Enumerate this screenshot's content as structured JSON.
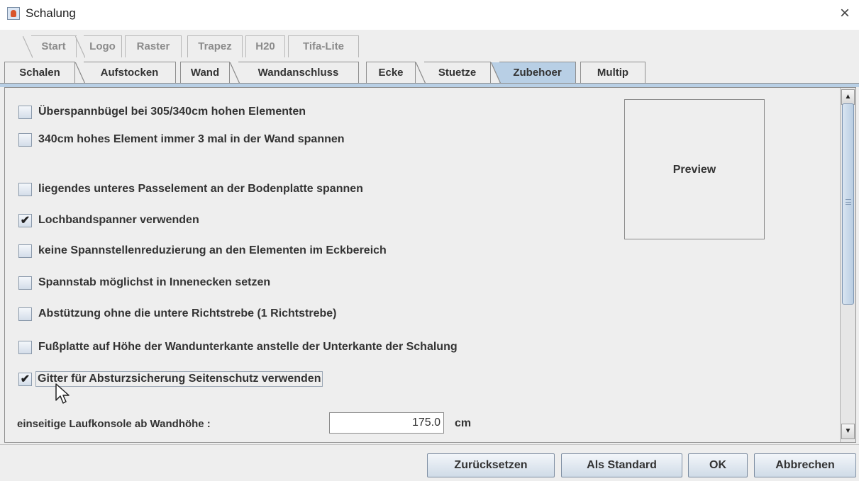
{
  "window": {
    "title": "Schalung",
    "close_symbol": "×",
    "app_icon": "java-cup-icon"
  },
  "tabs_row1": [
    "Start",
    "Logo",
    "Raster",
    "Trapez",
    "H20",
    "Tifa-Lite"
  ],
  "tabs_row2": [
    "Schalen",
    "Aufstocken",
    "Wand",
    "Wandanschluss",
    "Ecke",
    "Stuetze",
    "Zubehoer",
    "Multip"
  ],
  "selected_tab": "Zubehoer",
  "options": [
    {
      "label": "Überspannbügel bei 305/340cm hohen Elementen",
      "checked": false
    },
    {
      "label": "340cm hohes Element immer 3 mal in der Wand spannen",
      "checked": false
    },
    {
      "label": "liegendes unteres Passelement an der Bodenplatte spannen",
      "checked": false
    },
    {
      "label": "Lochbandspanner verwenden",
      "checked": true
    },
    {
      "label": "keine Spannstellenreduzierung an den Elementen im Eckbereich",
      "checked": false
    },
    {
      "label": "Spannstab möglichst in Innenecken setzen",
      "checked": false
    },
    {
      "label": "Abstützung ohne die untere Richtstrebe (1 Richtstrebe)",
      "checked": false
    },
    {
      "label": "Fußplatte auf Höhe der Wandunterkante anstelle der Unterkante der Schalung",
      "checked": false
    },
    {
      "label": "Gitter für Absturzsicherung Seitenschutz verwenden",
      "checked": true
    }
  ],
  "check_mark": "✔",
  "preview": {
    "label": "Preview"
  },
  "laufkonsole": {
    "label": "einseitige Laufkonsole ab Wandhöhe :",
    "value": "175.0",
    "unit": "cm"
  },
  "scrollbar": {
    "up": "▲",
    "down": "▼"
  },
  "buttons": {
    "reset": "Zurücksetzen",
    "default": "Als Standard",
    "ok": "OK",
    "cancel": "Abbrechen"
  }
}
